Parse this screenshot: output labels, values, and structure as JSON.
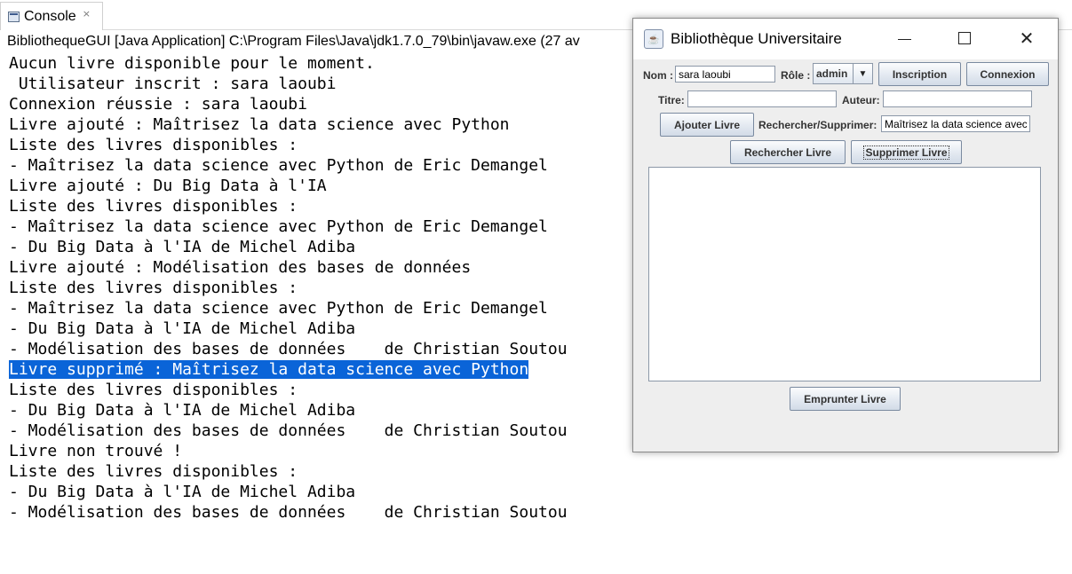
{
  "console": {
    "tab_label": "Console",
    "tab_close_icon": "×",
    "header": "BibliothequeGUI [Java Application] C:\\Program Files\\Java\\jdk1.7.0_79\\bin\\javaw.exe (27 av",
    "lines": [
      "Aucun livre disponible pour le moment.",
      " Utilisateur inscrit : sara laoubi",
      "Connexion réussie : sara laoubi",
      "Livre ajouté : Maîtrisez la data science avec Python",
      "Liste des livres disponibles :",
      "- Maîtrisez la data science avec Python de Eric Demangel",
      "Livre ajouté : Du Big Data à l'IA",
      "Liste des livres disponibles :",
      "- Maîtrisez la data science avec Python de Eric Demangel",
      "- Du Big Data à l'IA de Michel Adiba",
      "Livre ajouté : Modélisation des bases de données",
      "Liste des livres disponibles :",
      "- Maîtrisez la data science avec Python de Eric Demangel",
      "- Du Big Data à l'IA de Michel Adiba",
      "- Modélisation des bases de données    de Christian Soutou",
      "Livre supprimé : Maîtrisez la data science avec Python",
      "Liste des livres disponibles :",
      "- Du Big Data à l'IA de Michel Adiba",
      "- Modélisation des bases de données    de Christian Soutou",
      "Livre non trouvé !",
      "Liste des livres disponibles :",
      "- Du Big Data à l'IA de Michel Adiba",
      "- Modélisation des bases de données    de Christian Soutou"
    ],
    "highlighted_line_index": 15,
    "highlight_color": "#0a64d8"
  },
  "window": {
    "title": "Bibliothèque Universitaire",
    "java_icon_glyph": "☕",
    "close_glyph": "✕",
    "nom_label": "Nom :",
    "nom_value": "sara laoubi",
    "role_label": "Rôle :",
    "role_value": "admin",
    "role_arrow_glyph": "▼",
    "inscription_button": "Inscription",
    "connexion_button": "Connexion",
    "titre_label": "Titre:",
    "titre_value": "",
    "auteur_label": "Auteur:",
    "auteur_value": "",
    "ajouter_button": "Ajouter Livre",
    "rechercher_supprimer_label": "Rechercher/Supprimer:",
    "rechercher_supprimer_value": "Maîtrisez la data science avec",
    "rechercher_button": "Rechercher Livre",
    "supprimer_button": "Supprimer Livre",
    "emprunter_button": "Emprunter Livre",
    "result_text": ""
  }
}
